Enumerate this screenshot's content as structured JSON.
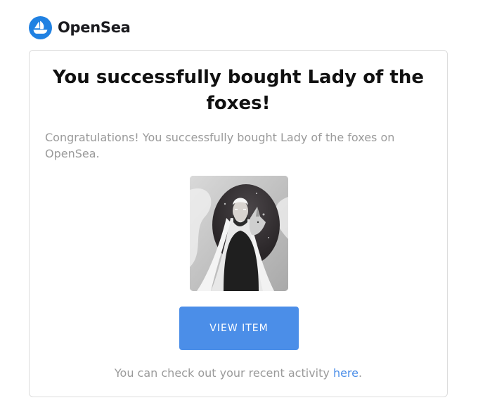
{
  "header": {
    "brand_name": "OpenSea",
    "logo_icon": "opensea-ship-logo-icon"
  },
  "email": {
    "title": "You successfully bought Lady of the foxes!",
    "message": "Congratulations! You successfully bought Lady of the foxes on OpenSea.",
    "item_image_icon": "nft-artwork-lady-with-fox",
    "view_button_label": "VIEW ITEM",
    "footer_prefix": "You can check out your recent activity ",
    "footer_link": "here",
    "footer_suffix": "."
  },
  "colors": {
    "accent": "#4b8ee8",
    "brand_blue": "#2081e2",
    "muted_text": "#9a9a9a",
    "title_text": "#111111",
    "card_border": "#dcdcdc"
  }
}
